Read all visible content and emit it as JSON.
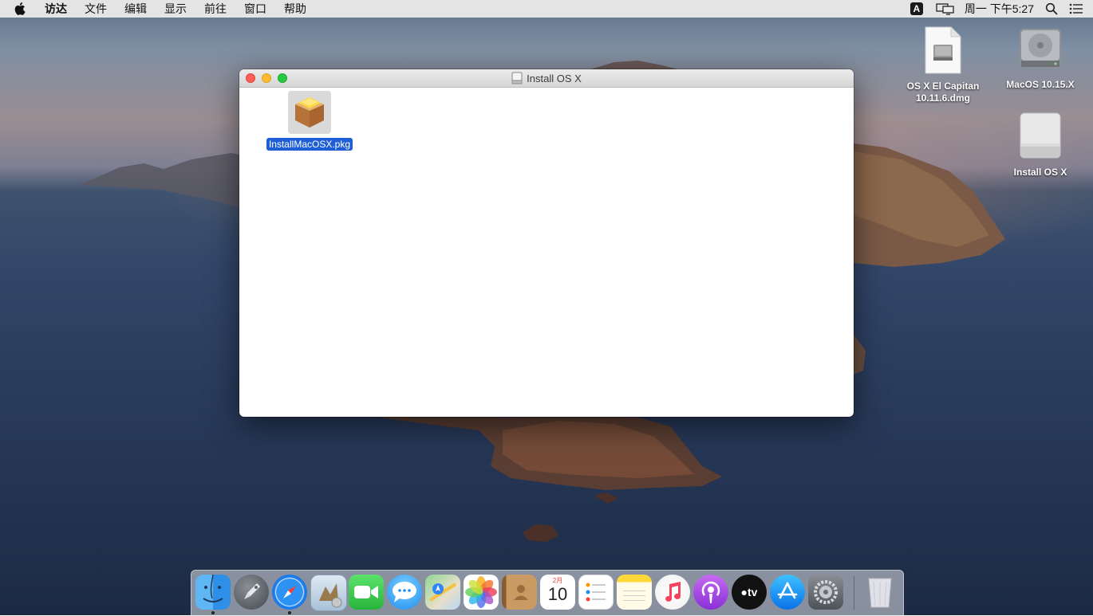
{
  "menubar": {
    "apple_icon": "apple-logo-icon",
    "items": [
      "访达",
      "文件",
      "编辑",
      "显示",
      "前往",
      "窗口",
      "帮助"
    ],
    "input_method": "A",
    "clock": "周一 下午5:27"
  },
  "desktop_icons": [
    {
      "label": "OS X El Capitan\n10.11.6.dmg",
      "icon": "dmg-file-icon"
    },
    {
      "label": "MacOS 10.15.X",
      "icon": "hard-drive-icon"
    },
    {
      "label": "Install OS X",
      "icon": "external-drive-icon"
    }
  ],
  "window": {
    "title": "Install OS X",
    "files": [
      {
        "name": "InstallMacOSX.pkg",
        "icon": "package-icon",
        "selected": true
      }
    ]
  },
  "dock": {
    "apps": [
      {
        "name": "Finder",
        "icon": "finder-icon",
        "running": true
      },
      {
        "name": "Launchpad",
        "icon": "launchpad-icon",
        "running": false
      },
      {
        "name": "Safari",
        "icon": "safari-icon",
        "running": true
      },
      {
        "name": "Mail",
        "icon": "mail-icon",
        "running": false
      },
      {
        "name": "FaceTime",
        "icon": "facetime-icon",
        "running": false
      },
      {
        "name": "Messages",
        "icon": "messages-icon",
        "running": false
      },
      {
        "name": "Maps",
        "icon": "maps-icon",
        "running": false
      },
      {
        "name": "Photos",
        "icon": "photos-icon",
        "running": false
      },
      {
        "name": "Contacts",
        "icon": "contacts-icon",
        "running": false
      },
      {
        "name": "Calendar",
        "icon": "calendar-icon",
        "running": false,
        "month": "2月",
        "day": "10"
      },
      {
        "name": "Reminders",
        "icon": "reminders-icon",
        "running": false
      },
      {
        "name": "Notes",
        "icon": "notes-icon",
        "running": false
      },
      {
        "name": "Music",
        "icon": "music-icon",
        "running": false
      },
      {
        "name": "Podcasts",
        "icon": "podcasts-icon",
        "running": false
      },
      {
        "name": "TV",
        "icon": "tv-icon",
        "running": false,
        "label": "tv"
      },
      {
        "name": "App Store",
        "icon": "app-store-icon",
        "running": false
      },
      {
        "name": "System Preferences",
        "icon": "system-preferences-icon",
        "running": false
      },
      {
        "name": "Trash",
        "icon": "trash-icon",
        "running": false
      }
    ]
  },
  "colors": {
    "selection": "#1f5fd6",
    "close": "#fe5f57",
    "minimize": "#febc2e",
    "zoom": "#28c840"
  }
}
